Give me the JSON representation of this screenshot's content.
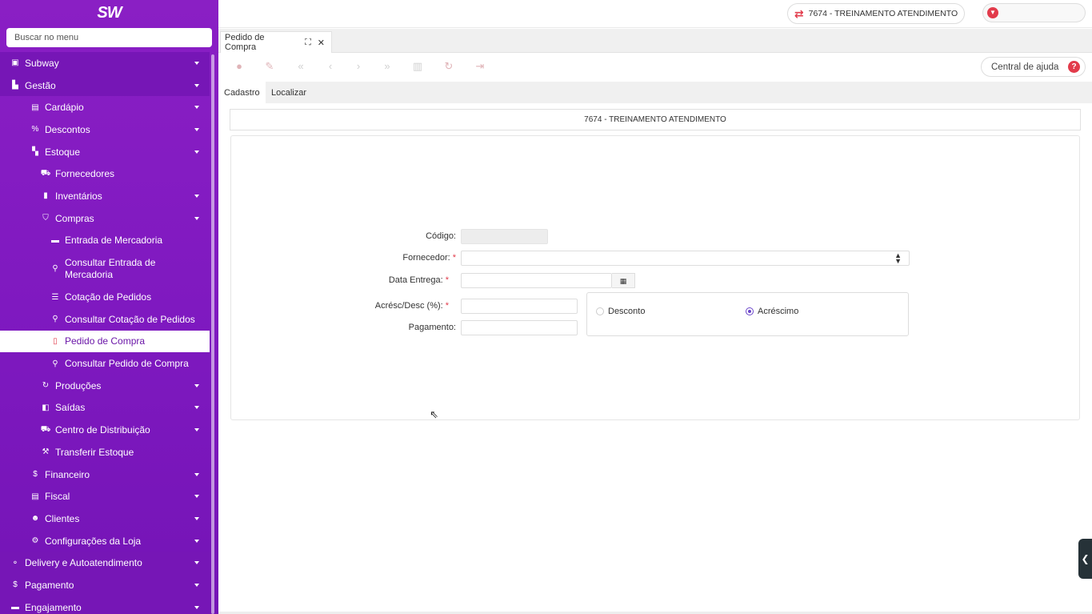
{
  "app": {
    "logo": "SW"
  },
  "sidebar": {
    "search_placeholder": "Buscar no menu",
    "items": [
      {
        "label": "Subway",
        "icon": "store-icon",
        "glyph": "▣",
        "level": "l1",
        "caret": true
      },
      {
        "label": "Gestão",
        "icon": "sitemap-icon",
        "glyph": "▙",
        "level": "l1",
        "caret": true
      },
      {
        "label": "Cardápio",
        "icon": "book-icon",
        "glyph": "▤",
        "level": "l2",
        "caret": true
      },
      {
        "label": "Descontos",
        "icon": "percent-icon",
        "glyph": "%",
        "level": "l2",
        "caret": true
      },
      {
        "label": "Estoque",
        "icon": "boxes-icon",
        "glyph": "▚",
        "level": "l2",
        "caret": true
      },
      {
        "label": "Fornecedores",
        "icon": "truck-icon",
        "glyph": "⛟",
        "level": "l3",
        "caret": false
      },
      {
        "label": "Inventários",
        "icon": "clipboard-icon",
        "glyph": "▮",
        "level": "l3",
        "caret": true
      },
      {
        "label": "Compras",
        "icon": "cart-icon",
        "glyph": "⛉",
        "level": "l3",
        "caret": true
      },
      {
        "label": "Entrada de Mercadoria",
        "icon": "archive-icon",
        "glyph": "▬",
        "level": "l4",
        "caret": false
      },
      {
        "label": "Consultar Entrada de Mercadoria",
        "icon": "search-icon",
        "glyph": "⚲",
        "level": "l4",
        "caret": false,
        "tall": true
      },
      {
        "label": "Cotação de Pedidos",
        "icon": "list-icon",
        "glyph": "☰",
        "level": "l4",
        "caret": false
      },
      {
        "label": "Consultar Cotação de Pedidos",
        "icon": "search-icon",
        "glyph": "⚲",
        "level": "l4",
        "caret": false
      },
      {
        "label": "Pedido de Compra",
        "icon": "file-icon",
        "glyph": "▯",
        "level": "l4",
        "caret": false,
        "active": true
      },
      {
        "label": "Consultar Pedido de Compra",
        "icon": "search-icon",
        "glyph": "⚲",
        "level": "l4",
        "caret": false
      },
      {
        "label": "Produções",
        "icon": "refresh-icon",
        "glyph": "↻",
        "level": "l3",
        "caret": true
      },
      {
        "label": "Saídas",
        "icon": "exit-icon",
        "glyph": "◧",
        "level": "l3",
        "caret": true
      },
      {
        "label": "Centro de Distribuição",
        "icon": "truck-icon",
        "glyph": "⛟",
        "level": "l3",
        "caret": true
      },
      {
        "label": "Transferir Estoque",
        "icon": "dolly-icon",
        "glyph": "⚒",
        "level": "l3",
        "caret": false
      },
      {
        "label": "Financeiro",
        "icon": "dollar-icon",
        "glyph": "$",
        "level": "l2",
        "caret": true
      },
      {
        "label": "Fiscal",
        "icon": "document-icon",
        "glyph": "▤",
        "level": "l2",
        "caret": true
      },
      {
        "label": "Clientes",
        "icon": "users-icon",
        "glyph": "☻",
        "level": "l2",
        "caret": true
      },
      {
        "label": "Configurações da Loja",
        "icon": "cogs-icon",
        "glyph": "⚙",
        "level": "l2",
        "caret": true
      },
      {
        "label": "Delivery e Autoatendimento",
        "icon": "motorcycle-icon",
        "glyph": "⚬",
        "level": "l1",
        "caret": true
      },
      {
        "label": "Pagamento",
        "icon": "dollar-icon",
        "glyph": "$",
        "level": "l1",
        "caret": true
      },
      {
        "label": "Engajamento",
        "icon": "card-icon",
        "glyph": "▬",
        "level": "l1",
        "caret": true
      }
    ]
  },
  "topbar": {
    "store_label": "7674 - TREINAMENTO ATENDIMENTO"
  },
  "tabs": [
    {
      "label": "Pedido de Compra"
    }
  ],
  "toolbar": {
    "help_label": "Central de ajuda",
    "help_glyph": "?"
  },
  "subtabs": [
    {
      "label": "Cadastro",
      "active": true
    },
    {
      "label": "Localizar",
      "active": false
    }
  ],
  "form": {
    "header": "7674 - TREINAMENTO ATENDIMENTO",
    "codigo_label": "Código:",
    "fornecedor_label": "Fornecedor:",
    "data_entrega_label": "Data Entrega:",
    "acresc_label": "Acrésc/Desc (%):",
    "pagamento_label": "Pagamento:",
    "required_mark": "*",
    "codigo_value": "",
    "fornecedor_value": "",
    "data_entrega_value": "",
    "acresc_value": "",
    "pagamento_value": "",
    "radio_desconto": "Desconto",
    "radio_acrescimo": "Acréscimo",
    "selected_radio": "Acréscimo"
  }
}
